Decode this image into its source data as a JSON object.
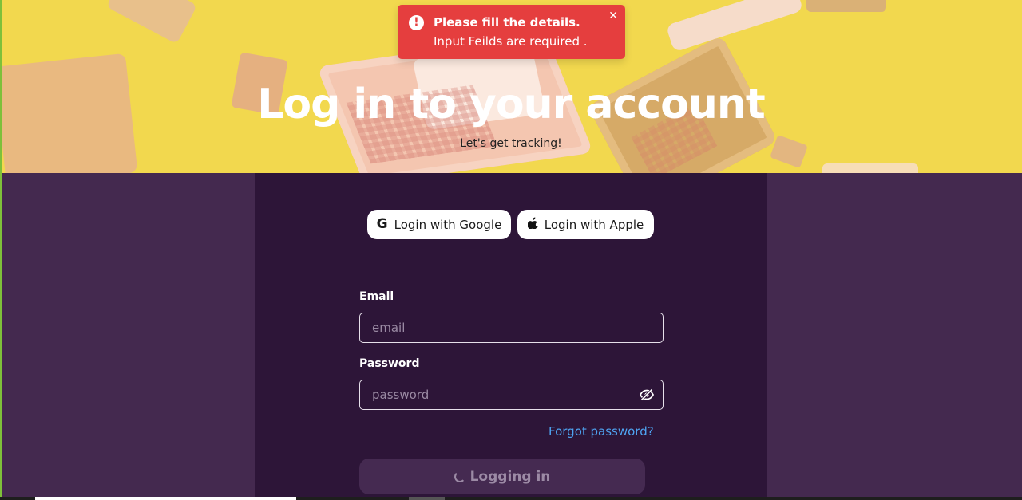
{
  "hero": {
    "title": "Log in to your account",
    "subtitle": "Let's get tracking!",
    "background_color": "#f2d84e"
  },
  "toast": {
    "title": "Please fill the details.",
    "description": "Input Feilds are required .",
    "icon": "error-icon",
    "icon_glyph": "!",
    "close_glyph": "✕",
    "color": "#e53e3e"
  },
  "auth": {
    "google_label": "Login with Google",
    "google_icon_glyph": "G",
    "apple_label": "Login with Apple",
    "apple_icon_glyph": ""
  },
  "form": {
    "email_label": "Email",
    "email_placeholder": "email",
    "email_value": "",
    "password_label": "Password",
    "password_placeholder": "password",
    "password_value": "",
    "password_toggle_icon": "eye-off-icon",
    "forgot_label": "Forgot password?",
    "submit_label": "Logging in",
    "submit_state": "loading"
  },
  "colors": {
    "page_bg": "#44294f",
    "panel_bg": "#2d1538",
    "link": "#4ea3f1",
    "button_disabled_bg": "#452a51"
  }
}
